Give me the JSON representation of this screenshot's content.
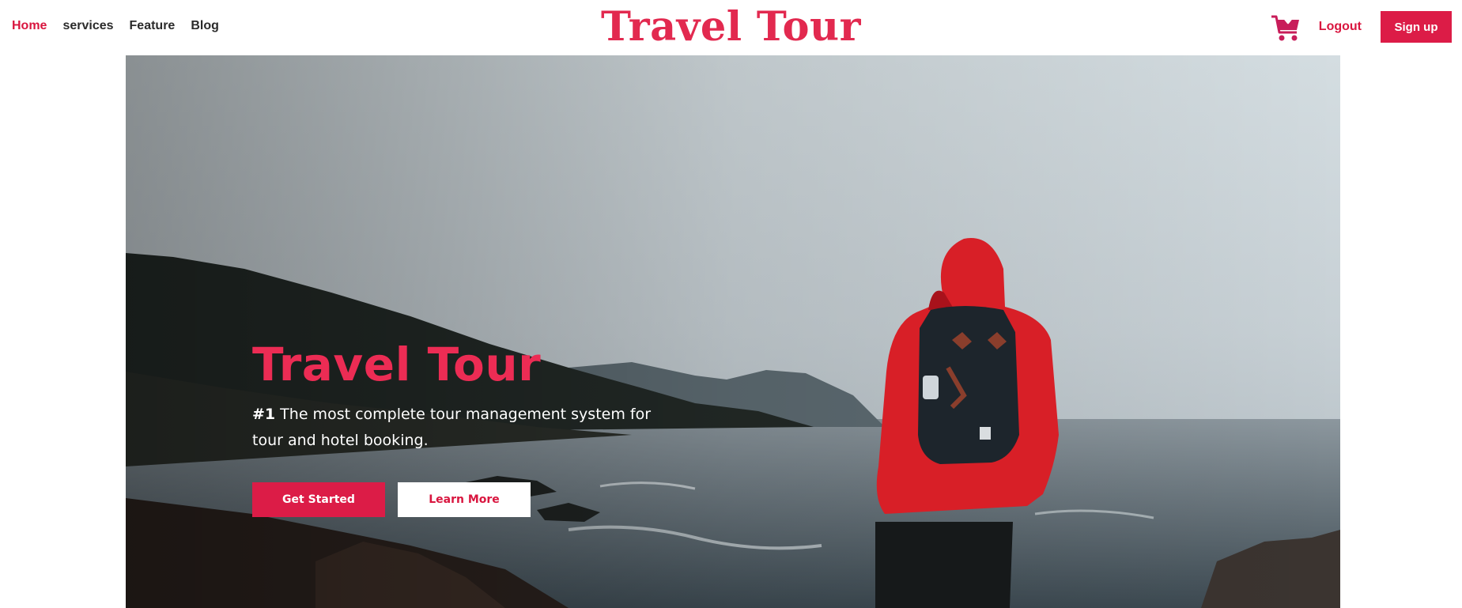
{
  "nav": {
    "items": [
      {
        "label": "Home",
        "active": true
      },
      {
        "label": "services",
        "active": false
      },
      {
        "label": "Feature",
        "active": false
      },
      {
        "label": "Blog",
        "active": false
      }
    ]
  },
  "brand": {
    "title": "Travel Tour"
  },
  "header_actions": {
    "cart_icon": "shopping-cart-icon",
    "logout_label": "Logout",
    "signup_label": "Sign up"
  },
  "hero": {
    "title": "Travel Tour",
    "subtitle_rank": "#1",
    "subtitle_text": " The most complete tour management system for tour and hotel booking.",
    "primary_button": "Get Started",
    "secondary_button": "Learn More"
  },
  "colors": {
    "accent": "#dc1c47",
    "brand_text": "#e2294f",
    "nav_text": "#2b2b2b"
  }
}
